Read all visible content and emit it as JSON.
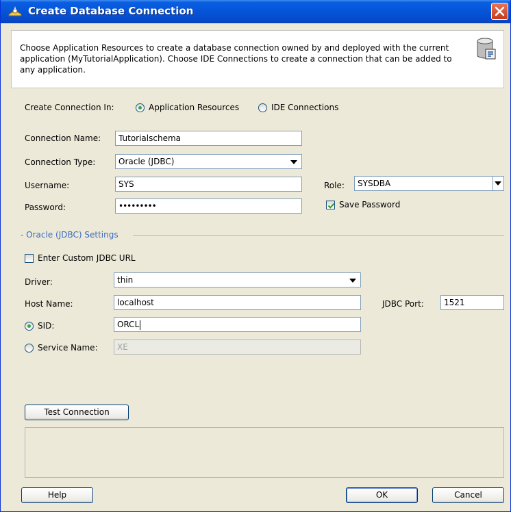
{
  "window": {
    "title": "Create Database Connection"
  },
  "header": {
    "description": "Choose Application Resources to create a database connection owned by and deployed with the current application (MyTutorialApplication). Choose IDE Connections to create a connection that can be added to any application."
  },
  "create_in": {
    "label": "Create Connection In:",
    "options": [
      "Application Resources",
      "IDE Connections"
    ],
    "selected": "Application Resources"
  },
  "form": {
    "connection_name_label": "Connection Name:",
    "connection_name_value": "Tutorialschema",
    "connection_type_label": "Connection Type:",
    "connection_type_value": "Oracle (JDBC)",
    "username_label": "Username:",
    "username_value": "SYS",
    "role_label": "Role:",
    "role_value": "SYSDBA",
    "password_label": "Password:",
    "password_value": "•••••••••",
    "save_password_label": "Save Password",
    "save_password_checked": true
  },
  "jdbc": {
    "section_title": "- Oracle (JDBC) Settings",
    "custom_url_label": "Enter Custom JDBC URL",
    "custom_url_checked": false,
    "driver_label": "Driver:",
    "driver_value": "thin",
    "host_label": "Host Name:",
    "host_value": "localhost",
    "port_label": "JDBC Port:",
    "port_value": "1521",
    "sid_label": "SID:",
    "sid_value": "ORCL",
    "service_label": "Service Name:",
    "service_value": "XE",
    "selected_mode": "SID"
  },
  "buttons": {
    "test_connection": "Test Connection",
    "help": "Help",
    "ok": "OK",
    "cancel": "Cancel"
  },
  "colors": {
    "title_bar": "#0554d8",
    "dialog_bg": "#ece9d8",
    "section_title": "#3c6bc0",
    "close_button": "#c63b1b"
  },
  "icons": [
    "app-title-icon",
    "close-icon",
    "database-icon",
    "checkmark-icon"
  ]
}
